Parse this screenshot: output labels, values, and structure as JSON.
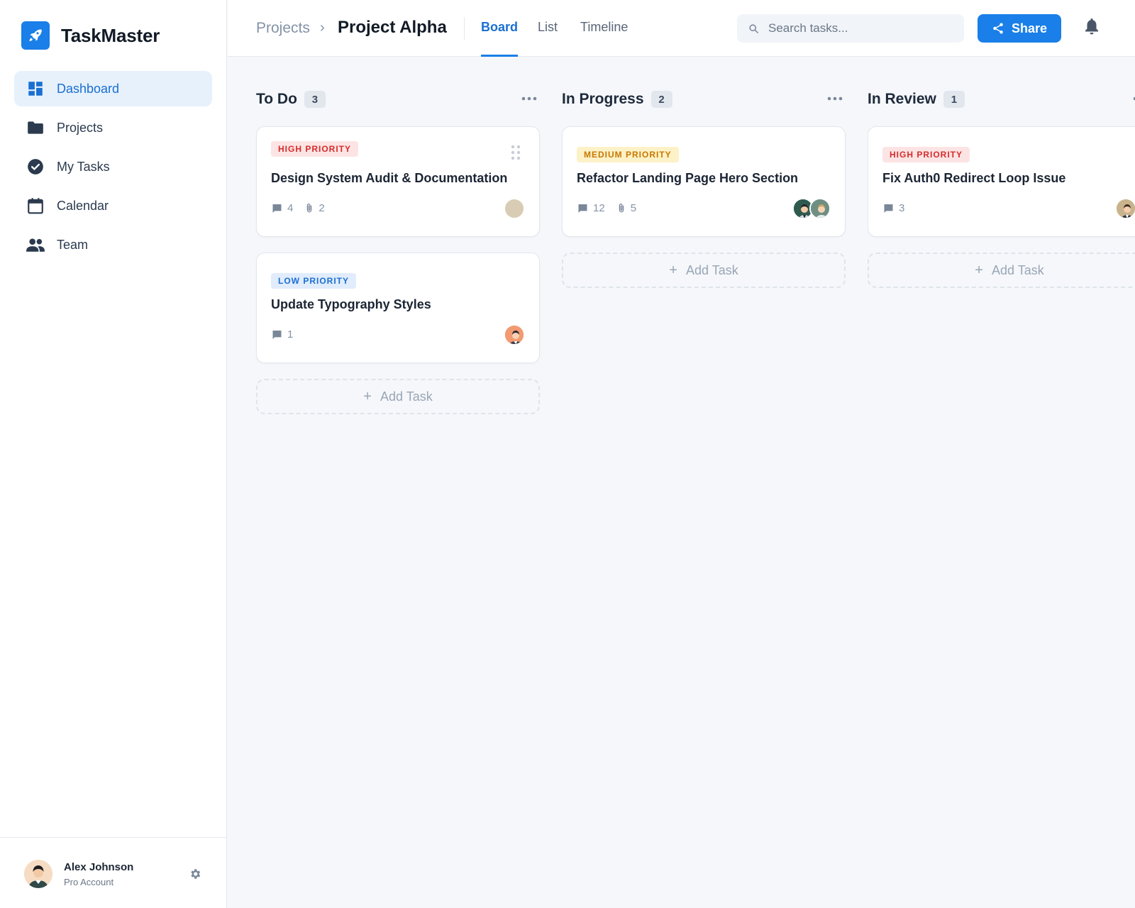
{
  "app": {
    "name": "TaskMaster",
    "logo_icon": "rocket-icon",
    "accent": "#1a7fe8"
  },
  "sidebar": {
    "items": [
      {
        "label": "Dashboard",
        "icon": "dashboard-icon",
        "active": true
      },
      {
        "label": "Projects",
        "icon": "folder-icon",
        "active": false
      },
      {
        "label": "My Tasks",
        "icon": "check-circle-icon",
        "active": false
      },
      {
        "label": "Calendar",
        "icon": "calendar-icon",
        "active": false
      },
      {
        "label": "Team",
        "icon": "team-icon",
        "active": false
      }
    ],
    "user": {
      "name": "Alex Johnson",
      "plan": "Pro Account"
    }
  },
  "header": {
    "breadcrumb_parent": "Projects",
    "breadcrumb_separator": "›",
    "breadcrumb_current": "Project Alpha",
    "tabs": [
      {
        "label": "Board",
        "active": true
      },
      {
        "label": "List",
        "active": false
      },
      {
        "label": "Timeline",
        "active": false
      }
    ],
    "search_placeholder": "Search tasks...",
    "share_label": "Share"
  },
  "board": {
    "add_task_label": "Add Task",
    "columns": [
      {
        "title": "To Do",
        "count": "3",
        "cards": [
          {
            "priority": "HIGH PRIORITY",
            "level": "high",
            "title": "Design System Audit & Documentation",
            "comments": "4",
            "attachments": "2"
          },
          {
            "priority": "LOW PRIORITY",
            "level": "low",
            "title": "Update Typography Styles",
            "comments": "1"
          }
        ]
      },
      {
        "title": "In Progress",
        "count": "2",
        "cards": [
          {
            "priority": "MEDIUM PRIORITY",
            "level": "medium",
            "title": "Refactor Landing Page Hero Section",
            "comments": "12",
            "attachments": "5"
          }
        ]
      },
      {
        "title": "In Review",
        "count": "1",
        "cards": [
          {
            "priority": "HIGH PRIORITY",
            "level": "high",
            "title": "Fix Auth0 Redirect Loop Issue",
            "comments": "3"
          }
        ]
      }
    ]
  }
}
